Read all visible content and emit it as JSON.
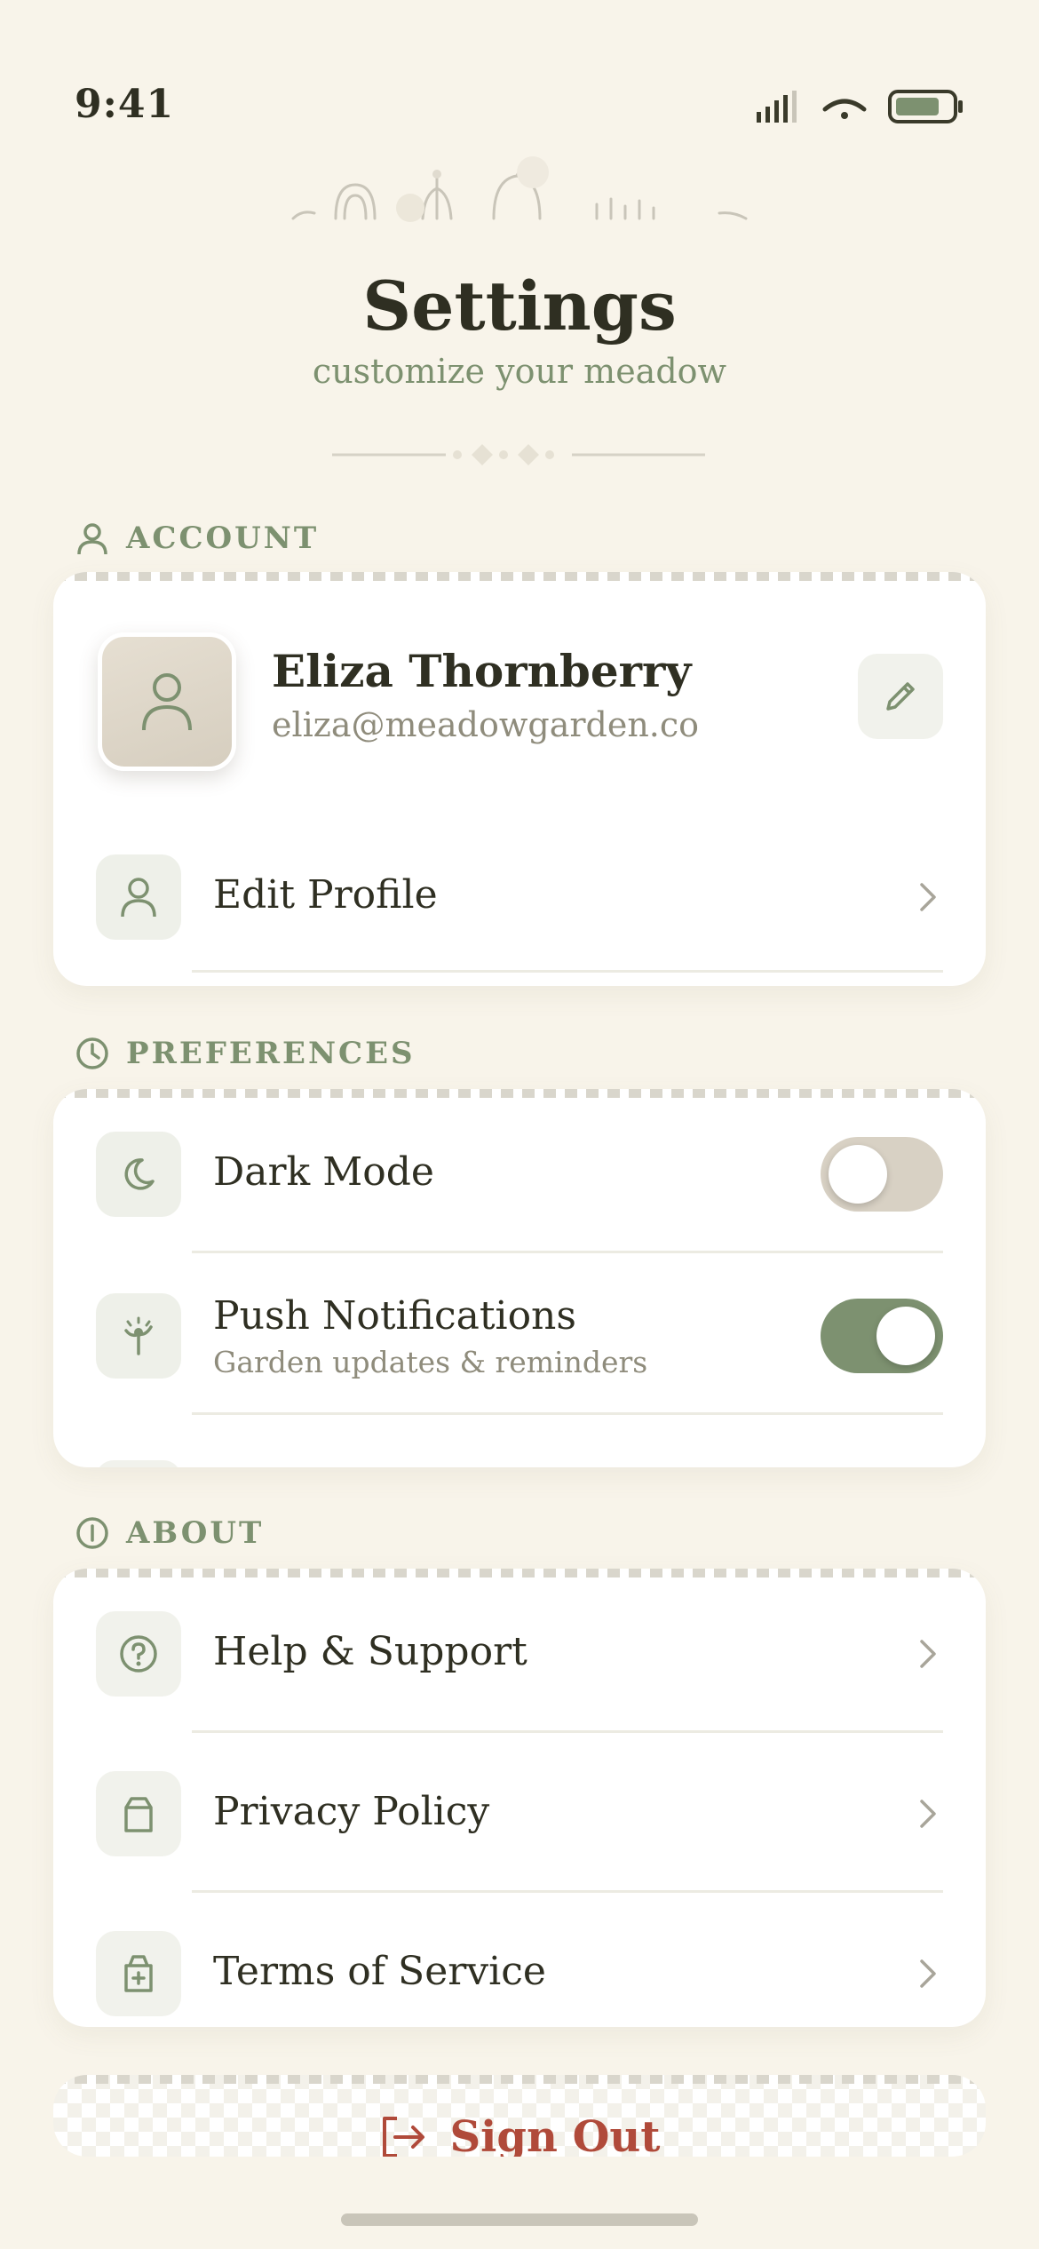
{
  "status_bar": {
    "time": "9:41"
  },
  "header": {
    "title": "Settings",
    "subtitle": "customize your meadow"
  },
  "account": {
    "section_label": "ACCOUNT",
    "profile": {
      "name": "Eliza Thornberry",
      "email": "eliza@meadowgarden.co"
    },
    "rows": [
      {
        "label": "Edit Profile"
      }
    ]
  },
  "preferences": {
    "section_label": "PREFERENCES",
    "rows": [
      {
        "label": "Dark Mode",
        "enabled": false
      },
      {
        "label": "Push Notifications",
        "sublabel": "Garden updates & reminders",
        "enabled": true
      }
    ]
  },
  "about": {
    "section_label": "ABOUT",
    "rows": [
      {
        "label": "Help & Support"
      },
      {
        "label": "Privacy Policy"
      },
      {
        "label": "Terms of Service"
      }
    ]
  },
  "sign_out": {
    "label": "Sign Out"
  },
  "colors": {
    "background": "#f8f4ea",
    "accent_sage": "#7d9170",
    "danger": "#b04a3a",
    "text_dark": "#2f2f22",
    "text_muted": "#8f8c7c"
  }
}
